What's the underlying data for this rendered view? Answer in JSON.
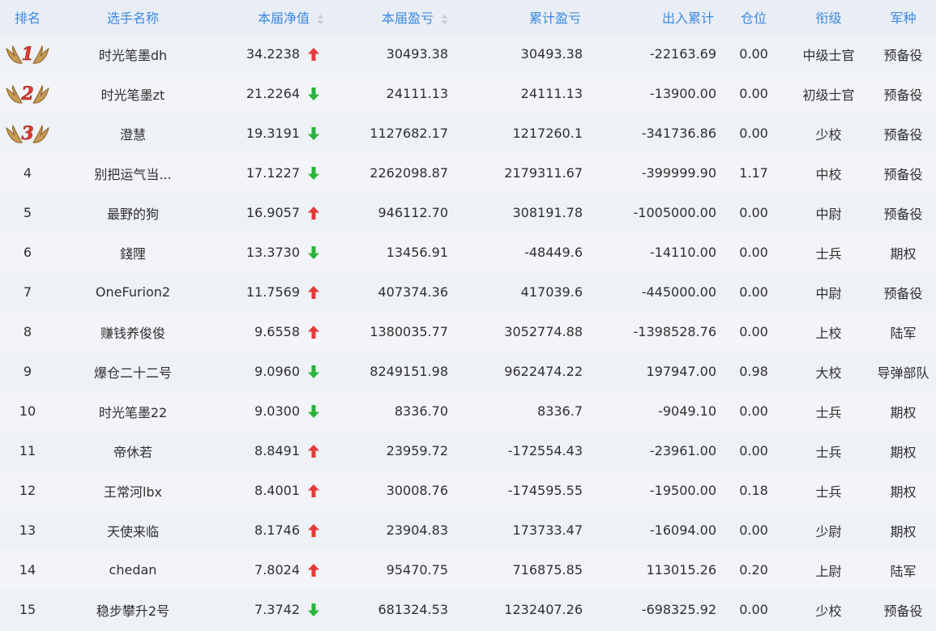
{
  "header": {
    "rank": "排名",
    "name": "选手名称",
    "nav": "本届净值",
    "pnl": "本届盈亏",
    "cum_pnl": "累计盈亏",
    "flow": "出入累计",
    "position": "仓位",
    "title": "衔级",
    "branch": "军种"
  },
  "colors": {
    "header_text": "#3d8be0",
    "up_arrow": "#e33b3b",
    "down_arrow": "#2bb33b",
    "medal_number": "#e23c2f"
  },
  "rows": [
    {
      "rank": "1",
      "medal": true,
      "name": "时光笔墨dh",
      "nav": "34.2238",
      "trend": "up",
      "pnl": "30493.38",
      "cum": "30493.38",
      "flow": "-22163.69",
      "pos": "0.00",
      "title": "中级士官",
      "branch": "预备役"
    },
    {
      "rank": "2",
      "medal": true,
      "name": "时光笔墨zt",
      "nav": "21.2264",
      "trend": "down",
      "pnl": "24111.13",
      "cum": "24111.13",
      "flow": "-13900.00",
      "pos": "0.00",
      "title": "初级士官",
      "branch": "预备役"
    },
    {
      "rank": "3",
      "medal": true,
      "name": "澄慧",
      "nav": "19.3191",
      "trend": "down",
      "pnl": "1127682.17",
      "cum": "1217260.1",
      "flow": "-341736.86",
      "pos": "0.00",
      "title": "少校",
      "branch": "预备役"
    },
    {
      "rank": "4",
      "medal": false,
      "name": "别把运气当...",
      "nav": "17.1227",
      "trend": "down",
      "pnl": "2262098.87",
      "cum": "2179311.67",
      "flow": "-399999.90",
      "pos": "1.17",
      "title": "中校",
      "branch": "预备役"
    },
    {
      "rank": "5",
      "medal": false,
      "name": "最野的狗",
      "nav": "16.9057",
      "trend": "up",
      "pnl": "946112.70",
      "cum": "308191.78",
      "flow": "-1005000.00",
      "pos": "0.00",
      "title": "中尉",
      "branch": "预备役"
    },
    {
      "rank": "6",
      "medal": false,
      "name": "錢䧉",
      "nav": "13.3730",
      "trend": "down",
      "pnl": "13456.91",
      "cum": "-48449.6",
      "flow": "-14110.00",
      "pos": "0.00",
      "title": "士兵",
      "branch": "期权"
    },
    {
      "rank": "7",
      "medal": false,
      "name": "OneFurion2",
      "nav": "11.7569",
      "trend": "up",
      "pnl": "407374.36",
      "cum": "417039.6",
      "flow": "-445000.00",
      "pos": "0.00",
      "title": "中尉",
      "branch": "预备役"
    },
    {
      "rank": "8",
      "medal": false,
      "name": "赚钱养俊俊",
      "nav": "9.6558",
      "trend": "up",
      "pnl": "1380035.77",
      "cum": "3052774.88",
      "flow": "-1398528.76",
      "pos": "0.00",
      "title": "上校",
      "branch": "陆军"
    },
    {
      "rank": "9",
      "medal": false,
      "name": "爆仓二十二号",
      "nav": "9.0960",
      "trend": "down",
      "pnl": "8249151.98",
      "cum": "9622474.22",
      "flow": "197947.00",
      "pos": "0.98",
      "title": "大校",
      "branch": "导弹部队"
    },
    {
      "rank": "10",
      "medal": false,
      "name": "时光笔墨22",
      "nav": "9.0300",
      "trend": "down",
      "pnl": "8336.70",
      "cum": "8336.7",
      "flow": "-9049.10",
      "pos": "0.00",
      "title": "士兵",
      "branch": "期权"
    },
    {
      "rank": "11",
      "medal": false,
      "name": "帝休若",
      "nav": "8.8491",
      "trend": "up",
      "pnl": "23959.72",
      "cum": "-172554.43",
      "flow": "-23961.00",
      "pos": "0.00",
      "title": "士兵",
      "branch": "期权"
    },
    {
      "rank": "12",
      "medal": false,
      "name": "王常河lbx",
      "nav": "8.4001",
      "trend": "up",
      "pnl": "30008.76",
      "cum": "-174595.55",
      "flow": "-19500.00",
      "pos": "0.18",
      "title": "士兵",
      "branch": "期权"
    },
    {
      "rank": "13",
      "medal": false,
      "name": "天使来临",
      "nav": "8.1746",
      "trend": "up",
      "pnl": "23904.83",
      "cum": "173733.47",
      "flow": "-16094.00",
      "pos": "0.00",
      "title": "少尉",
      "branch": "期权"
    },
    {
      "rank": "14",
      "medal": false,
      "name": "chedan",
      "nav": "7.8024",
      "trend": "up",
      "pnl": "95470.75",
      "cum": "716875.85",
      "flow": "113015.26",
      "pos": "0.20",
      "title": "上尉",
      "branch": "陆军"
    },
    {
      "rank": "15",
      "medal": false,
      "name": "稳步攀升2号",
      "nav": "7.3742",
      "trend": "down",
      "pnl": "681324.53",
      "cum": "1232407.26",
      "flow": "-698325.92",
      "pos": "0.00",
      "title": "少校",
      "branch": "预备役"
    }
  ]
}
